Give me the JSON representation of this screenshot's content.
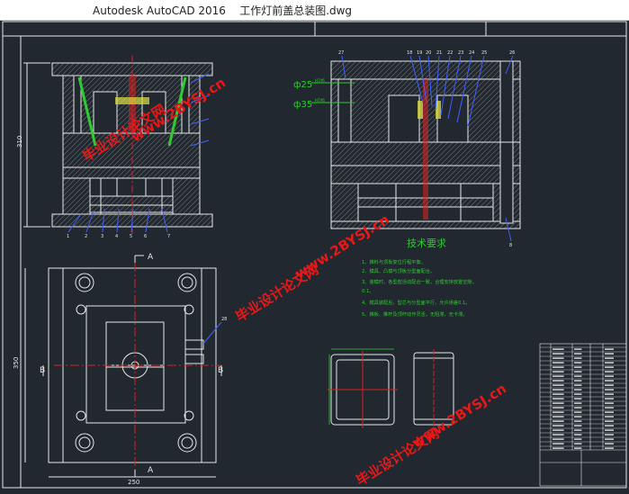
{
  "window": {
    "app_name": "Autodesk AutoCAD 2016",
    "file_name": "工作灯前盖总装图.dwg"
  },
  "drawing": {
    "tech_title": "技术要求",
    "tech_notes": [
      "1、推料与顶板复位行程平衡。",
      "2、模具、凸模与顶板分型面配合。",
      "3、装模时，各型腔活动配合一致，合理安排放置空隙，",
      "0.1。",
      "4、模具装配后，型芯与分型面平行，允许误差0.1。",
      "5、推板、推杆及顶杆动作灵活，无阻滞，无卡滞。"
    ],
    "dims": {
      "left_height": "310",
      "plan_height": "350",
      "plan_width": "250",
      "phi1": "ф25",
      "phi1_tol": "H7/f6",
      "phi2": "ф35",
      "phi2_tol": "H7/f6"
    },
    "section_labels": {
      "top_a": "A",
      "bottom_a": "A",
      "left_b": "B",
      "right_b": "B"
    },
    "balloons_left": [
      "1",
      "2",
      "3",
      "4",
      "5",
      "6",
      "7"
    ],
    "balloons_right_top": [
      "18",
      "19",
      "20",
      "21",
      "22",
      "23",
      "24",
      "25",
      "26",
      "27"
    ],
    "balloons_bottom_right": [
      "8"
    ],
    "balloon_plan": [
      "28"
    ],
    "watermarks": {
      "url": "www.2BYSJ.cn",
      "cn": "毕业设计论文网"
    },
    "colors": {
      "background": "#212830",
      "line_white": "#e6e6e6",
      "hatch": "#7a7a7a",
      "accent_red": "#e02020",
      "accent_green": "#2ecc2e",
      "accent_blue": "#4060ff",
      "accent_yellow": "#e0e040",
      "watermark_red": "#e81818"
    }
  }
}
